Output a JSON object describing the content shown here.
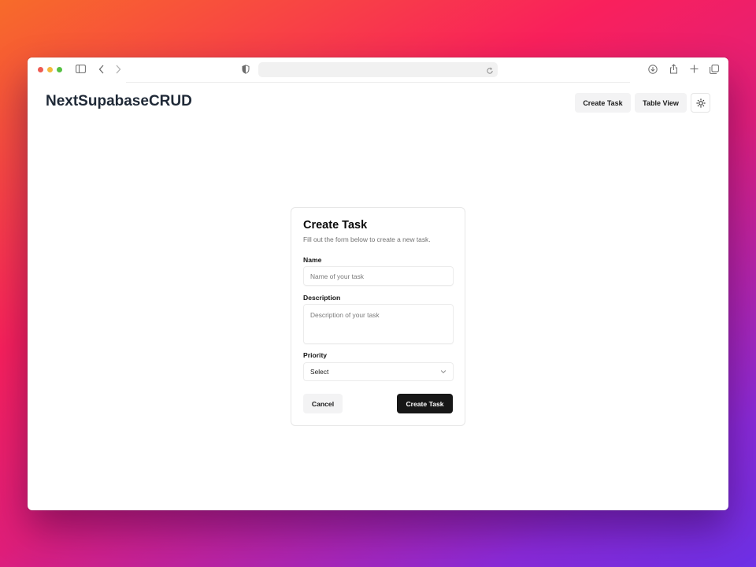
{
  "browser": {
    "icons": [
      "sidebar-icon",
      "back-icon",
      "forward-icon",
      "shield-icon",
      "reload-icon",
      "download-icon",
      "share-icon",
      "new-tab-icon",
      "tabs-overview-icon"
    ],
    "address": ""
  },
  "header": {
    "brand": "NextSupabaseCRUD",
    "nav": {
      "create_task": "Create Task",
      "table_view": "Table View"
    },
    "theme_icon": "sun-icon"
  },
  "form": {
    "title": "Create Task",
    "subtitle": "Fill out the form below to create a new task.",
    "name": {
      "label": "Name",
      "placeholder": "Name of your task",
      "value": ""
    },
    "description": {
      "label": "Description",
      "placeholder": "Description of your task",
      "value": ""
    },
    "priority": {
      "label": "Priority",
      "selected": "Select",
      "icon": "chevron-down-icon"
    },
    "buttons": {
      "cancel": "Cancel",
      "submit": "Create Task"
    }
  },
  "colors": {
    "primary_button": "#171717",
    "secondary_button": "#f3f3f4",
    "brand_text": "#1f2937",
    "window_bg": "#ffffff"
  }
}
